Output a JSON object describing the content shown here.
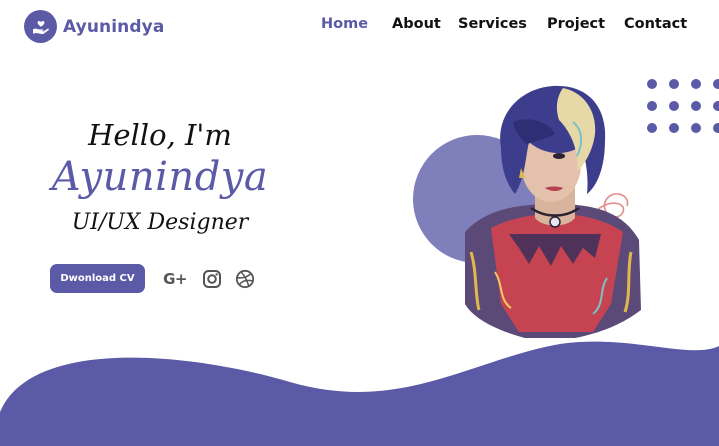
{
  "brand": {
    "name": "Ayunindya"
  },
  "nav": {
    "items": [
      {
        "label": "Home",
        "active": true
      },
      {
        "label": "About"
      },
      {
        "label": "Services"
      },
      {
        "label": "Project"
      },
      {
        "label": "Contact"
      }
    ]
  },
  "hero": {
    "greeting": "Hello, I'm",
    "name": "Ayunindya",
    "role": "UI/UX Designer",
    "cta_label": "Dwonload CV"
  },
  "social": {
    "icons": [
      "google-plus-icon",
      "instagram-icon",
      "dribbble-icon"
    ],
    "google_plus_glyph": "G+"
  },
  "colors": {
    "accent": "#5a5aa6",
    "accent_light": "#7f7fbc",
    "text": "#111111",
    "background": "#ffffff"
  }
}
